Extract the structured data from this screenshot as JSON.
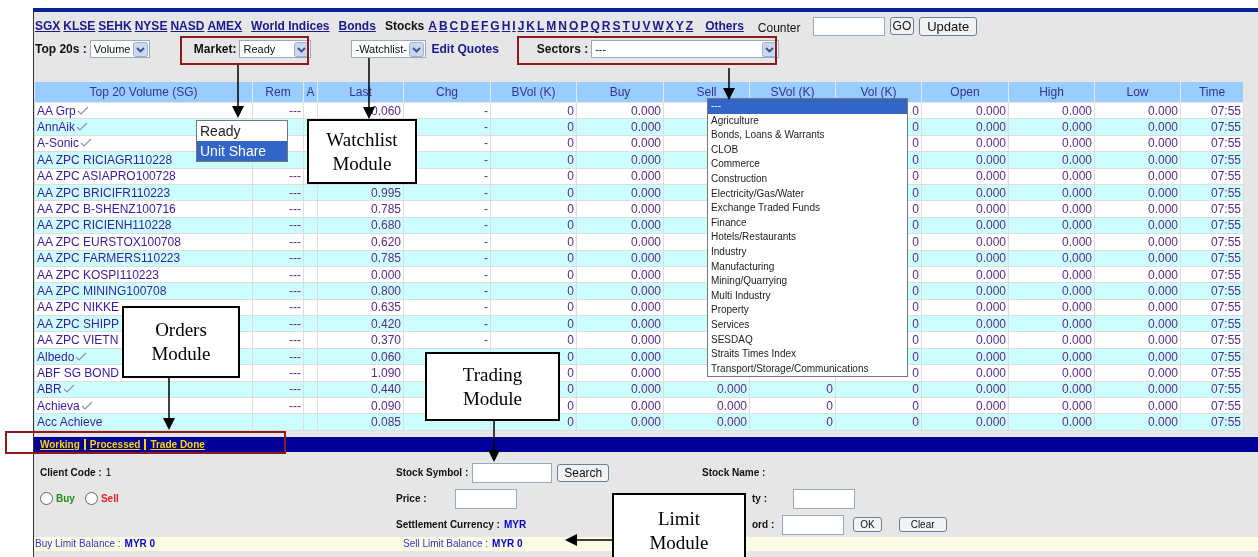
{
  "top_nav": {
    "exchanges": [
      "SGX",
      "KLSE",
      "SEHK",
      "NYSE",
      "NASD",
      "AMEX"
    ],
    "world_indices": "World Indices",
    "bonds": "Bonds",
    "stocks_label": "Stocks",
    "letters": [
      "A",
      "B",
      "C",
      "D",
      "E",
      "F",
      "G",
      "H",
      "I",
      "J",
      "K",
      "L",
      "M",
      "N",
      "O",
      "P",
      "Q",
      "R",
      "S",
      "T",
      "U",
      "V",
      "W",
      "X",
      "Y",
      "Z"
    ],
    "others": "Others",
    "counter_label": "Counter",
    "go_button": "GO",
    "update_button": "Update"
  },
  "filters": {
    "top20_label": "Top 20s :",
    "top20_value": "Volume",
    "market_label": "Market:",
    "market_value": "Ready",
    "watchlist_value": "-Watchlist-",
    "edit_quotes": "Edit Quotes",
    "sectors_label": "Sectors :",
    "sectors_value": "---"
  },
  "table": {
    "columns": [
      "Top 20 Volume (SG)",
      "Rem",
      "A",
      "Last",
      "Chg",
      "BVol (K)",
      "Buy",
      "Sell",
      "SVol (K)",
      "Vol (K)",
      "Open",
      "High",
      "Low",
      "Time"
    ],
    "rows": [
      {
        "name": "AA Grp",
        "tick": true,
        "rem": "---",
        "last": "0.060",
        "chg": "-",
        "bvol": "0",
        "buy": "0.000",
        "vol": "0",
        "open": "0.000",
        "high": "0.000",
        "low": "0.000",
        "time": "07:55"
      },
      {
        "name": "AnnAik",
        "tick": true,
        "chg": "-",
        "bvol": "0",
        "buy": "0.000",
        "vol": "0",
        "open": "0.000",
        "high": "0.000",
        "low": "0.000",
        "time": "07:55"
      },
      {
        "name": "A-Sonic",
        "tick": true,
        "chg": "-",
        "bvol": "0",
        "buy": "0.000",
        "vol": "0",
        "open": "0.000",
        "high": "0.000",
        "low": "0.000",
        "time": "07:55"
      },
      {
        "name": "AA ZPC RICIAGR110228",
        "tick": false,
        "chg": "-",
        "bvol": "0",
        "buy": "0.000",
        "vol": "0",
        "open": "0.000",
        "high": "0.000",
        "low": "0.000",
        "time": "07:55"
      },
      {
        "name": "AA ZPC ASIAPRO100728",
        "tick": false,
        "rem": "---",
        "chg": "-",
        "bvol": "0",
        "buy": "0.000",
        "vol": "0",
        "open": "0.000",
        "high": "0.000",
        "low": "0.000",
        "time": "07:55"
      },
      {
        "name": "AA ZPC BRICIFR110223",
        "tick": false,
        "rem": "---",
        "last": "0.995",
        "chg": "-",
        "bvol": "0",
        "buy": "0.000",
        "vol": "0",
        "open": "0.000",
        "high": "0.000",
        "low": "0.000",
        "time": "07:55"
      },
      {
        "name": "AA ZPC B-SHENZ100716",
        "tick": false,
        "rem": "---",
        "last": "0.785",
        "chg": "-",
        "bvol": "0",
        "buy": "0.000",
        "vol": "0",
        "open": "0.000",
        "high": "0.000",
        "low": "0.000",
        "time": "07:55"
      },
      {
        "name": "AA ZPC RICIENH110228",
        "tick": false,
        "rem": "---",
        "last": "0.680",
        "chg": "-",
        "bvol": "0",
        "buy": "0.000",
        "vol": "0",
        "open": "0.000",
        "high": "0.000",
        "low": "0.000",
        "time": "07:55"
      },
      {
        "name": "AA ZPC EURSTOX100708",
        "tick": false,
        "rem": "---",
        "last": "0.620",
        "chg": "-",
        "bvol": "0",
        "buy": "0.000",
        "vol": "0",
        "open": "0.000",
        "high": "0.000",
        "low": "0.000",
        "time": "07:55"
      },
      {
        "name": "AA ZPC FARMERS110223",
        "tick": false,
        "rem": "---",
        "last": "0.785",
        "chg": "-",
        "bvol": "0",
        "buy": "0.000",
        "vol": "0",
        "open": "0.000",
        "high": "0.000",
        "low": "0.000",
        "time": "07:55"
      },
      {
        "name": "AA ZPC KOSPI110223",
        "tick": false,
        "rem": "---",
        "last": "0.000",
        "chg": "-",
        "bvol": "0",
        "buy": "0.000",
        "vol": "0",
        "open": "0.000",
        "high": "0.000",
        "low": "0.000",
        "time": "07:55"
      },
      {
        "name": "AA ZPC MINING100708",
        "tick": false,
        "rem": "---",
        "last": "0.800",
        "chg": "-",
        "bvol": "0",
        "buy": "0.000",
        "vol": "0",
        "open": "0.000",
        "high": "0.000",
        "low": "0.000",
        "time": "07:55"
      },
      {
        "name": "AA ZPC NIKKE",
        "tick": false,
        "rem": "---",
        "last": "0.635",
        "chg": "-",
        "bvol": "0",
        "buy": "0.000",
        "vol": "0",
        "open": "0.000",
        "high": "0.000",
        "low": "0.000",
        "time": "07:55"
      },
      {
        "name": "AA ZPC SHIPP",
        "tick": false,
        "rem": "---",
        "last": "0.420",
        "chg": "-",
        "bvol": "0",
        "buy": "0.000",
        "vol": "0",
        "open": "0.000",
        "high": "0.000",
        "low": "0.000",
        "time": "07:55"
      },
      {
        "name": "AA ZPC VIETN",
        "tick": false,
        "rem": "---",
        "last": "0.370",
        "chg": "-",
        "bvol": "0",
        "buy": "0.000",
        "vol": "0",
        "open": "0.000",
        "high": "0.000",
        "low": "0.000",
        "time": "07:55"
      },
      {
        "name": "Albedo",
        "tick": true,
        "rem": "---",
        "last": "0.060",
        "bvol": "0",
        "buy": "0.000",
        "vol": "0",
        "open": "0.000",
        "high": "0.000",
        "low": "0.000",
        "time": "07:55"
      },
      {
        "name": "ABF SG BOND",
        "tick": false,
        "rem": "---",
        "last": "1.090",
        "bvol": "0",
        "buy": "0.000",
        "vol": "0",
        "open": "0.000",
        "high": "0.000",
        "low": "0.000",
        "time": "07:55"
      },
      {
        "name": "ABR",
        "tick": true,
        "rem": "---",
        "last": "0.440",
        "bvol": "0",
        "buy": "0.000",
        "sell": "0.000",
        "svol": "0",
        "vol": "0",
        "open": "0.000",
        "high": "0.000",
        "low": "0.000",
        "time": "07:55"
      },
      {
        "name": "Achieva",
        "tick": true,
        "rem": "---",
        "last": "0.090",
        "bvol": "0",
        "buy": "0.000",
        "sell": "0.000",
        "svol": "0",
        "vol": "0",
        "open": "0.000",
        "high": "0.000",
        "low": "0.000",
        "time": "07:55"
      },
      {
        "name": "Acc Achieve",
        "tick": false,
        "last": "0.085",
        "bvol": "0",
        "buy": "0.000",
        "sell": "0.000",
        "svol": "0",
        "vol": "0",
        "open": "0.000",
        "high": "0.000",
        "low": "0.000",
        "time": "07:55"
      }
    ]
  },
  "market_dropdown": {
    "options": [
      {
        "label": "Ready",
        "selected": false
      },
      {
        "label": "Unit Share",
        "selected": true
      }
    ]
  },
  "sectors_dropdown": {
    "options": [
      {
        "label": "---",
        "selected": true
      },
      {
        "label": "Agriculture",
        "selected": false
      },
      {
        "label": "Bonds, Loans & Warrants",
        "selected": false
      },
      {
        "label": "CLOB",
        "selected": false
      },
      {
        "label": "Commerce",
        "selected": false
      },
      {
        "label": "Construction",
        "selected": false
      },
      {
        "label": "Electricity/Gas/Water",
        "selected": false
      },
      {
        "label": "Exchange Traded Funds",
        "selected": false
      },
      {
        "label": "Finance",
        "selected": false
      },
      {
        "label": "Hotels/Restaurants",
        "selected": false
      },
      {
        "label": "Industry",
        "selected": false
      },
      {
        "label": "Manufacturing",
        "selected": false
      },
      {
        "label": "Mining/Quarrying",
        "selected": false
      },
      {
        "label": "Multi Industry",
        "selected": false
      },
      {
        "label": "Property",
        "selected": false
      },
      {
        "label": "Services",
        "selected": false
      },
      {
        "label": "SESDAQ",
        "selected": false
      },
      {
        "label": "Straits Times Index",
        "selected": false
      },
      {
        "label": "Transport/Storage/Communications",
        "selected": false
      }
    ]
  },
  "order_tabs": [
    {
      "label": "Working"
    },
    {
      "label": "Processed"
    },
    {
      "label": "Trade Done"
    }
  ],
  "trade_form": {
    "client_code_label": "Client Code :",
    "client_code": "1",
    "sides": [
      {
        "label": "Buy",
        "selected": false,
        "color": "#228b22"
      },
      {
        "label": "Sell",
        "selected": false,
        "color": "#ee2222"
      }
    ],
    "stock_symbol_label": "Stock Symbol :",
    "search_button": "Search",
    "stock_name_label": "Stock Name :",
    "price_label": "Price :",
    "quantity_label": "ty :",
    "settlement_label": "Settlement Currency :",
    "settlement_currency": "MYR",
    "password_label": "ord :",
    "ok_button": "OK",
    "clear_button": "Clear"
  },
  "limits": {
    "buy_label": "Buy Limit Balance :",
    "buy_value": "MYR 0",
    "sell_label": "Sell Limit Balance :",
    "sell_value": "MYR 0"
  },
  "annotations": [
    {
      "text": "Watchlist Module"
    },
    {
      "text": "Orders Module"
    },
    {
      "text": "Trading Module"
    },
    {
      "text": "Limit Module"
    }
  ]
}
